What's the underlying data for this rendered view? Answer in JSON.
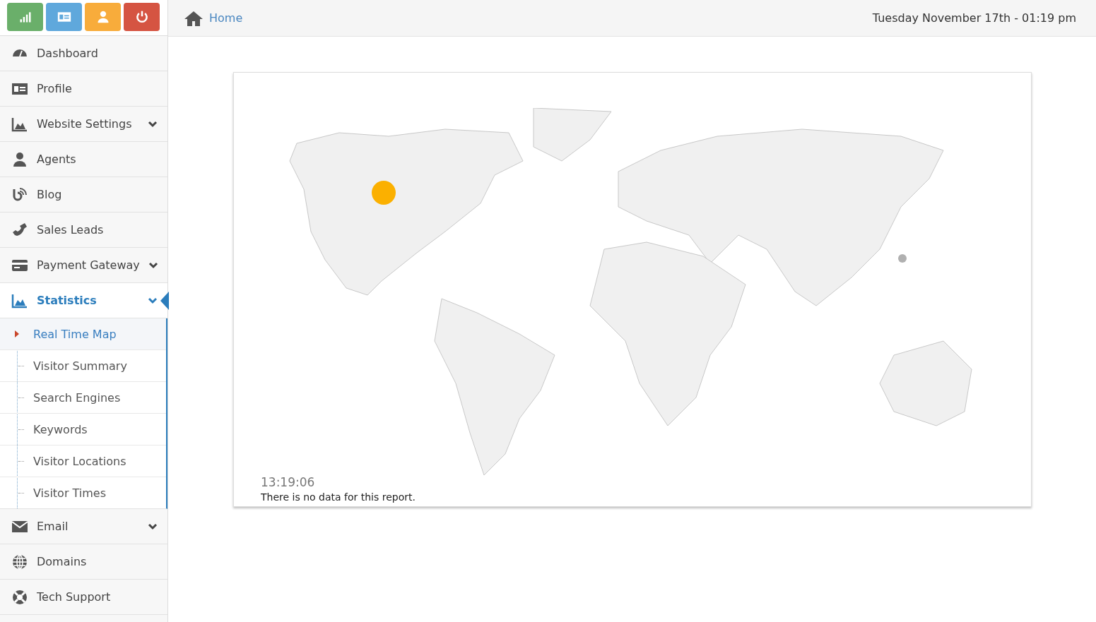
{
  "quick_buttons": [
    {
      "color": "#6aaf6a"
    },
    {
      "color": "#5fa8dc"
    },
    {
      "color": "#f8ac3b"
    },
    {
      "color": "#d55442"
    }
  ],
  "sidebar": {
    "items": [
      {
        "label": "Dashboard",
        "selected": false
      },
      {
        "label": "Profile",
        "selected": false
      },
      {
        "label": "Website Settings",
        "selected": false,
        "expanded": false
      },
      {
        "label": "Agents",
        "selected": false
      },
      {
        "label": "Blog",
        "selected": false
      },
      {
        "label": "Sales Leads",
        "selected": false
      },
      {
        "label": "Payment Gateway",
        "selected": false,
        "expanded": false
      },
      {
        "label": "Statistics",
        "selected": true,
        "expanded": true,
        "children": [
          {
            "label": "Real Time Map",
            "selected": true
          },
          {
            "label": "Visitor Summary",
            "selected": false
          },
          {
            "label": "Search Engines",
            "selected": false
          },
          {
            "label": "Keywords",
            "selected": false
          },
          {
            "label": "Visitor Locations",
            "selected": false
          },
          {
            "label": "Visitor Times",
            "selected": false
          }
        ]
      },
      {
        "label": "Email",
        "selected": false,
        "expanded": false
      },
      {
        "label": "Domains",
        "selected": false
      },
      {
        "label": "Tech Support",
        "selected": false
      }
    ]
  },
  "header": {
    "breadcrumb": "Home",
    "datetime": "Tuesday November 17th - 01:19 pm"
  },
  "map_card": {
    "time": "13:19:06",
    "message": "There is no data for this report."
  }
}
